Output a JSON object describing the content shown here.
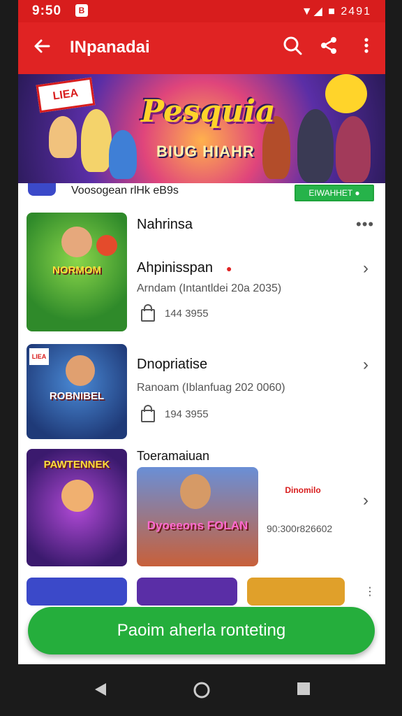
{
  "status_bar": {
    "time": "9:50",
    "notification_badge": "B",
    "right_text": "▼◢ ■ 2491"
  },
  "app_bar": {
    "title": "INpanadai",
    "back_icon": "arrow-left-icon",
    "search_icon": "search-icon",
    "share_icon": "share-icon",
    "more_icon": "more-vert-icon"
  },
  "hero": {
    "tag": "LIEA",
    "title": "Pesquia",
    "subtitle": "BIUG HIAHR"
  },
  "sub_row": {
    "text": "Voosogean rlHk eB9s",
    "badge": "EIWAHHET ●"
  },
  "cards": [
    {
      "thumb_label": "NORMOM",
      "title": "Nahrinsa",
      "subtitle": "Ahpinisspan",
      "meta": "Arndam (Intantldei 20a 2035)",
      "lock_value": "144 3955"
    },
    {
      "thumb_label": "ROBNIBEL",
      "title": "Dnopriatise",
      "meta": "Ranoam (Iblanfuag 202 0060)",
      "lock_value": "194 3955"
    },
    {
      "thumb_label": "PAWTENNEK",
      "title": "Toeramaiuan",
      "thumb2_label": "Dyoeeons FOLAN",
      "mini_logo": "Dinomilo",
      "meta": "90:300r826602"
    }
  ],
  "cta": {
    "label": "Paoim aherla ronteting"
  },
  "colors": {
    "brand_red": "#e02323",
    "cta_green": "#25ae3c"
  }
}
